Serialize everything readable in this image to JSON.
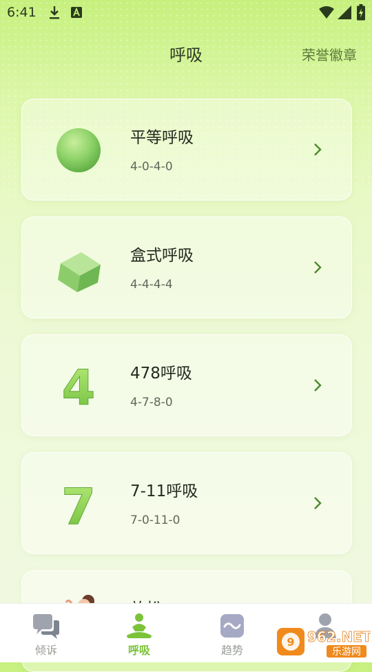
{
  "status_bar": {
    "time": "6:41"
  },
  "header": {
    "title": "呼吸",
    "honor_link": "荣誉徽章"
  },
  "cards": [
    {
      "title": "平等呼吸",
      "subtitle": "4-0-4-0",
      "icon": "green-sphere-icon"
    },
    {
      "title": "盒式呼吸",
      "subtitle": "4-4-4-4",
      "icon": "green-cube-icon"
    },
    {
      "title": "478呼吸",
      "subtitle": "4-7-8-0",
      "icon": "number-4-icon",
      "icon_text": "4"
    },
    {
      "title": "7-11呼吸",
      "subtitle": "7-0-11-0",
      "icon": "number-7-icon",
      "icon_text": "7"
    },
    {
      "title": "放松",
      "subtitle": "",
      "icon": "meditating-woman-icon"
    }
  ],
  "tabbar": {
    "tabs": [
      {
        "label": "倾诉",
        "icon": "chat-bubbles-icon",
        "active": false
      },
      {
        "label": "呼吸",
        "icon": "meditation-icon",
        "active": true
      },
      {
        "label": "趋势",
        "icon": "wave-icon",
        "active": false
      },
      {
        "label": "",
        "icon": "person-icon",
        "active": false
      }
    ]
  },
  "watermark": {
    "text_top": "962.NET",
    "text_bottom": "乐游网"
  },
  "colors": {
    "accent_green": "#7cc33a",
    "title_text": "#2e3b24",
    "link_text": "#5d7a3a",
    "inactive_tab": "#9a9e97"
  }
}
